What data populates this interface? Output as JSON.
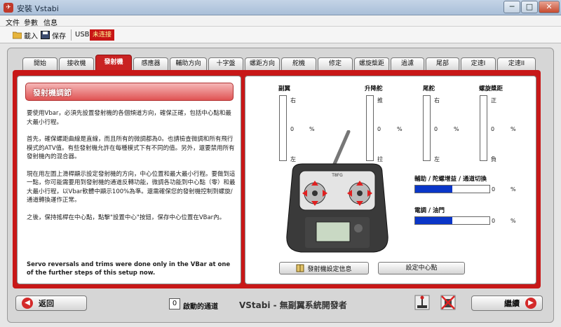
{
  "window": {
    "title": "安裝 Vstabi",
    "btn_min": "─",
    "btn_max": "□",
    "btn_close": "✕"
  },
  "menu": {
    "items": [
      "文件",
      "參數",
      "信息"
    ]
  },
  "toolbar": {
    "load": "載入",
    "save": "保存",
    "usb": "USB",
    "status": "未连接"
  },
  "tabs": [
    "開始",
    "接收機",
    "發射機",
    "感應器",
    "輔助方向",
    "十字盤",
    "螺距方向",
    "舵機",
    "修定",
    "螺旋槳距",
    "過濾",
    "尾部",
    "定速I",
    "定速II"
  ],
  "active_tab": "發射機",
  "left": {
    "header": "發射機調節",
    "paragraphs": [
      "要使用Vbar，必須先設置發射機的各個頻道方向，確保正確，包括中心點和最大最小行程。",
      "首先，確保螺距曲線是直線，而且所有的微調都為0。也請檢查微調和所有飛行模式的ATV值。有些發射機允許在每種模式下有不同的值。另外，還要禁用所有發射機內的混合器。",
      "現在用左圖上滑桿顯示設定發射機的方向，中心位置和最大最小行程。要做到這一點，你可能需要用到發射機的通道反轉功能，微調各功能到中心點（零）和最大最小行程，以Vbar軟體中顯示100%為準。還需確保您的發射機控制到螺旋/通道轉換運作正常。",
      "之後，保持搖桿在中心點，點擊\"設置中心\"按鈕，保存中心位置在VBar內。"
    ],
    "note": "Servo reversals and trims were done only in the VBar at one of the further steps of this setup now."
  },
  "channels": [
    {
      "title": "副翼",
      "top": "右",
      "bottom": "左",
      "value": "0",
      "unit": "%"
    },
    {
      "title": "升降舵",
      "top": "推",
      "bottom": "拉",
      "value": "0",
      "unit": "%"
    },
    {
      "title": "尾舵",
      "top": "右",
      "bottom": "左",
      "value": "0",
      "unit": "%"
    },
    {
      "title": "螺旋槳距",
      "top": "正",
      "bottom": "負",
      "value": "0",
      "unit": "%"
    }
  ],
  "gain_bar": {
    "label": "輔助 / 陀螺增益 / 通道切換",
    "value": "0",
    "unit": "%",
    "fill": 0.5
  },
  "throttle_bar": {
    "label": "電調 / 油門",
    "value": "0",
    "unit": "%",
    "fill": 0.5
  },
  "radio_brand": "T8FG",
  "buttons": {
    "tx_info": "發射機設定信息",
    "set_center": "設定中心點"
  },
  "bottom": {
    "back": "返回",
    "channel_count": "0",
    "channel_label": "啟動的通道",
    "app_title": "VStabi - 無副翼系統開發者",
    "next": "繼續"
  }
}
